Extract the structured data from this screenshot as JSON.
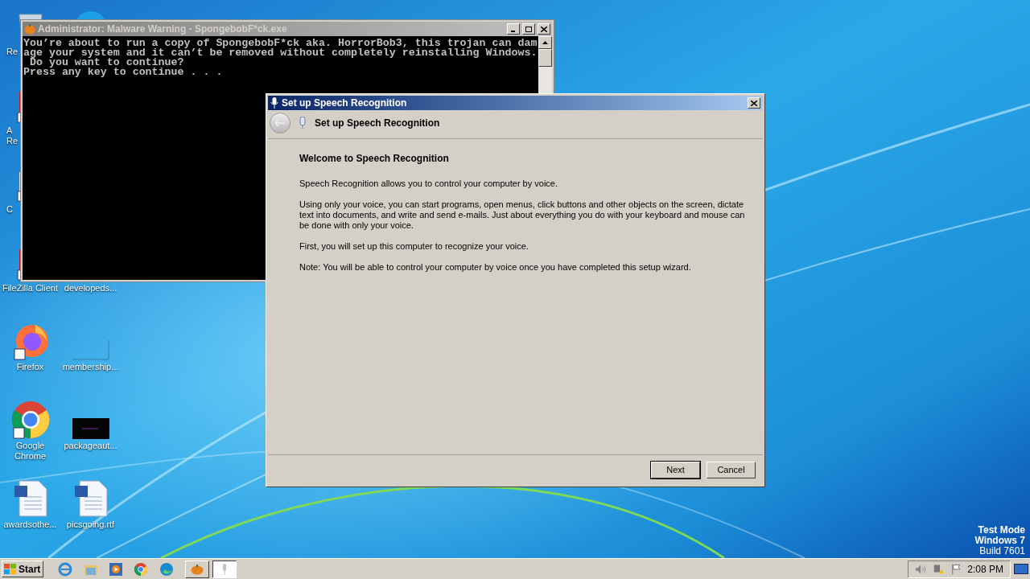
{
  "desktop_icon_columns": [
    {
      "icons": [
        {
          "kind": "recycle",
          "lines": [
            "Re"
          ],
          "clipped": true
        },
        {
          "kind": "pdf",
          "lines": [
            "A",
            "Re"
          ],
          "clipped": true
        },
        {
          "kind": "app",
          "lines": [
            "C"
          ],
          "clipped": true
        },
        {
          "kind": "filezilla",
          "lines": [
            "FileZilla Client"
          ],
          "clipped": false
        },
        {
          "kind": "firefox",
          "lines": [
            "Firefox"
          ],
          "clipped": false
        },
        {
          "kind": "chrome",
          "lines": [
            "Google",
            "Chrome"
          ],
          "clipped": false
        },
        {
          "kind": "word",
          "lines": [
            "awardsothe..."
          ],
          "clipped": false
        }
      ]
    },
    {
      "icons": [
        {
          "kind": "skype"
        },
        {
          "kind": "none"
        },
        {
          "kind": "none"
        },
        {
          "kind": "none",
          "lines": [
            "developeds..."
          ],
          "clipped": false
        },
        {
          "kind": "blank",
          "lines": [
            "membership..."
          ],
          "clipped": false
        },
        {
          "kind": "terminal",
          "lines": [
            "packageaut..."
          ],
          "clipped": false
        },
        {
          "kind": "word",
          "lines": [
            "picsgoing.rtf"
          ],
          "clipped": false
        }
      ]
    }
  ],
  "console_window": {
    "title": "Administrator:  Malware Warning - SpongebobF*ck.exe",
    "active": false,
    "lines": [
      "You’re about to run a copy of SpongebobF*ck aka. HorrorBob3, this trojan can dam",
      "age your system and it can’t be removed without completely reinstalling Windows.",
      " Do you want to continue?",
      "Press any key to continue . . ."
    ]
  },
  "dialog": {
    "title": "Set up Speech Recognition",
    "active": true,
    "header": "Set up Speech Recognition",
    "heading": "Welcome to Speech Recognition",
    "paragraphs": [
      "Speech Recognition allows you to control your computer by voice.",
      "Using only your voice, you can start programs, open menus, click buttons and other objects on the screen, dictate text into documents, and write and send e-mails. Just about everything you do with your keyboard and mouse can be done with only your voice.",
      "First, you will set up this computer to recognize your voice.",
      "Note: You will be able to control your computer by voice once you have completed this setup wizard."
    ],
    "buttons": [
      {
        "label": "Next",
        "default": true
      },
      {
        "label": "Cancel",
        "default": false
      }
    ]
  },
  "watermark_text": [
    "Test Mode",
    "Windows 7",
    "Build 7601"
  ],
  "taskbar": {
    "start": "Start",
    "quick_launch": [
      {
        "kind": "ie"
      },
      {
        "kind": "folder"
      },
      {
        "kind": "media"
      },
      {
        "kind": "chrome"
      },
      {
        "kind": "edge"
      }
    ],
    "tasks": [
      {
        "kind": "pumpkin",
        "selected": false
      },
      {
        "kind": "mic",
        "selected": true
      }
    ],
    "clock": "2:08 PM"
  }
}
